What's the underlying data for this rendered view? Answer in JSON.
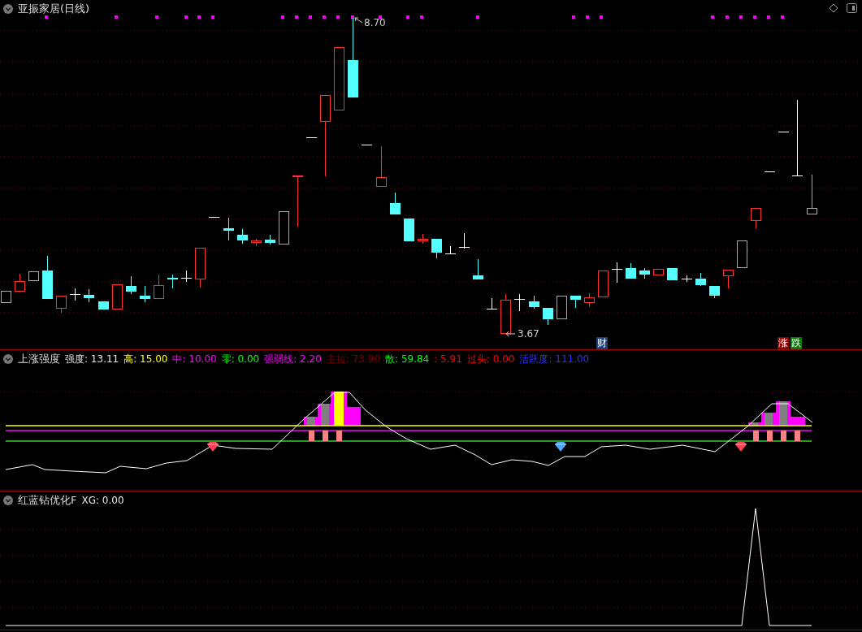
{
  "main_chart": {
    "title": "亚振家居(日线)",
    "high_label": "8.70",
    "low_label": "3.67",
    "event_markers": [
      {
        "text": "财",
        "kind": "finance"
      },
      {
        "text": "涨",
        "kind": "up"
      },
      {
        "text": "跌",
        "kind": "down"
      }
    ]
  },
  "indicator_1": {
    "name": "上涨强度",
    "legend": [
      {
        "text": "强度: 13.11",
        "color": "#e8e8e8"
      },
      {
        "text": "高: 15.00",
        "color": "#ffff00"
      },
      {
        "text": "中: 10.00",
        "color": "#ff00ff"
      },
      {
        "text": "零: 0.00",
        "color": "#00ff00"
      },
      {
        "text": "强弱线: 2.20",
        "color": "#ff00ff"
      },
      {
        "text": "主拉: 73.90",
        "color": "#800000"
      },
      {
        "text": "散: 59.84",
        "color": "#00ff00"
      },
      {
        "text": ": 5.91",
        "color": "#ff0000"
      },
      {
        "text": "过头: 0.00",
        "color": "#ff0000"
      },
      {
        "text": "活跃度: 111.00",
        "color": "#3030ff"
      }
    ]
  },
  "indicator_2": {
    "name": "红蓝钻优化F",
    "legend": [
      {
        "text": "XG: 0.00",
        "color": "#e8e8e8"
      }
    ]
  }
}
